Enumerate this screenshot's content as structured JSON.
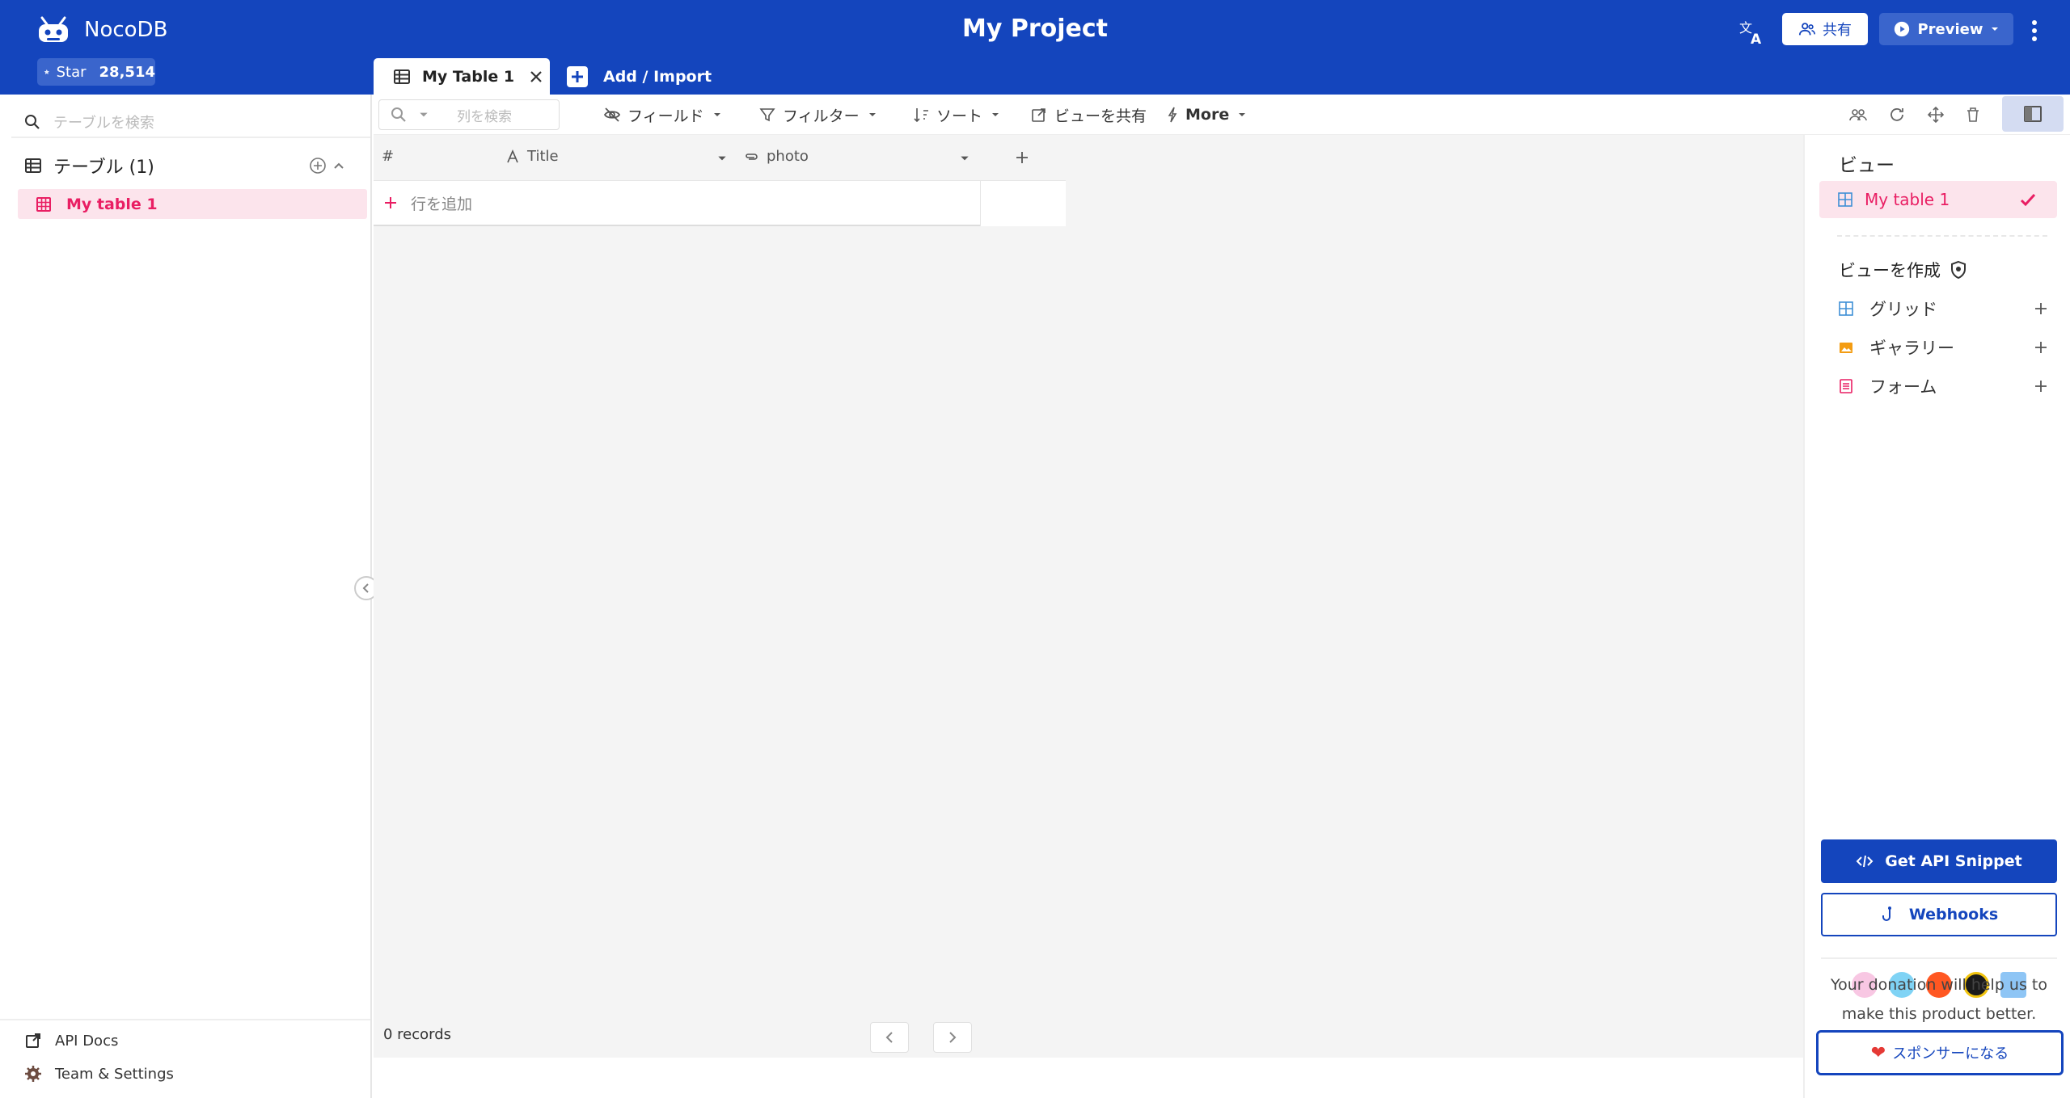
{
  "header": {
    "brand": "NocoDB",
    "star_label": "Star",
    "star_count": "28,514",
    "project_title": "My Project",
    "share_label": "共有",
    "preview_label": "Preview"
  },
  "tabs": [
    {
      "label": "My Table 1",
      "active": true
    },
    {
      "label": "Add / Import",
      "active": false
    }
  ],
  "sidebar": {
    "search_placeholder": "テーブルを検索",
    "tables_heading": "テーブル (1)",
    "tables": [
      {
        "label": "My table 1"
      }
    ],
    "footer_links": [
      {
        "label": "API Docs"
      },
      {
        "label": "Team & Settings"
      }
    ]
  },
  "toolbar": {
    "search_placeholder": "列を検索",
    "fields_label": "フィールド",
    "filter_label": "フィルター",
    "sort_label": "ソート",
    "share_view_label": "ビューを共有",
    "more_label": "More"
  },
  "grid": {
    "columns": [
      {
        "label": "#"
      },
      {
        "label": "Title",
        "icon": "text-type-icon"
      },
      {
        "label": "photo",
        "icon": "attachment-icon"
      }
    ],
    "add_row_label": "行を追加",
    "records_label": "0 records"
  },
  "right_panel": {
    "views_title": "ビュー",
    "views": [
      {
        "label": "My table 1",
        "selected": true
      }
    ],
    "create_view_title": "ビューを作成",
    "view_types": [
      {
        "label": "グリッド",
        "color": "#3f8fd6"
      },
      {
        "label": "ギャラリー",
        "color": "#f39c12"
      },
      {
        "label": "フォーム",
        "color": "#e91e63"
      }
    ],
    "api_snippet_label": "Get API Snippet",
    "webhooks_label": "Webhooks",
    "donation_text": "Your donation will help us to make this product better.",
    "sponsor_label": "スポンサーになる"
  },
  "colors": {
    "brand_blue": "#1445bd",
    "accent_pink": "#e91e63",
    "selected_bg": "#fce4ec"
  }
}
